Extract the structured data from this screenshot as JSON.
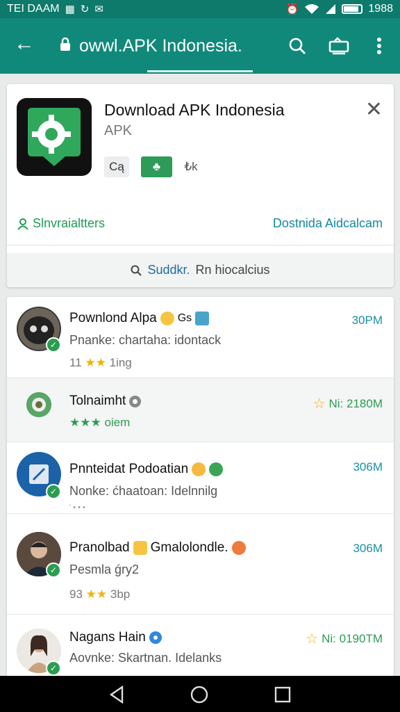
{
  "status_bar": {
    "left_text": "TEI DAAM",
    "right_text": "1988",
    "battery_level": 0.85
  },
  "app_bar": {
    "url": "owwl.APK Indonesia.",
    "icons": [
      "back-arrow-icon",
      "lock-icon",
      "search-icon",
      "cast-icon",
      "more-vert-icon"
    ]
  },
  "app_card": {
    "title": "Download APK Indonesia",
    "subtitle": "APK",
    "chip1": "Cą",
    "chip2": "♣",
    "chip3": "₺k",
    "link_left": "Slnvraialtters",
    "link_right": "Dostnida Aidcalcam",
    "search_query": "Suddkr.",
    "search_rest": "Rn hiocalcius"
  },
  "list": [
    {
      "title": "Pownlond Alpa",
      "sub": "Pnanke: chartaha: idontack",
      "meta_num": "11",
      "meta_stars": "★★",
      "meta_rest": "1ing",
      "size": "30PM"
    },
    {
      "title": "Tolnaimht",
      "meta_stars": "★★★",
      "meta_rest": "oiem",
      "size": "Ni: 2180M"
    },
    {
      "title": "Pnnteidat Podoatian",
      "sub": "Nonke: ćhaatoan: Idelnnilg",
      "meta_rest": "' • • • ",
      "size": "306M"
    },
    {
      "title": "Pranolbad",
      "title2": "Gmalolondle.",
      "sub": "Pesmla ǵry2",
      "meta_num": "93",
      "meta_stars": "★★",
      "meta_rest": "3bp",
      "size": "306M"
    },
    {
      "title": "Nagans Hain",
      "sub": "Aovnke: Skartnan. Idelanks",
      "size": "Ni: 0190TM"
    }
  ],
  "colors": {
    "status_bar": "#0d7a6b",
    "app_bar": "#11897a",
    "accent_green": "#2b9d50",
    "accent_blue": "#1a8fa8",
    "star": "#f0b400"
  }
}
